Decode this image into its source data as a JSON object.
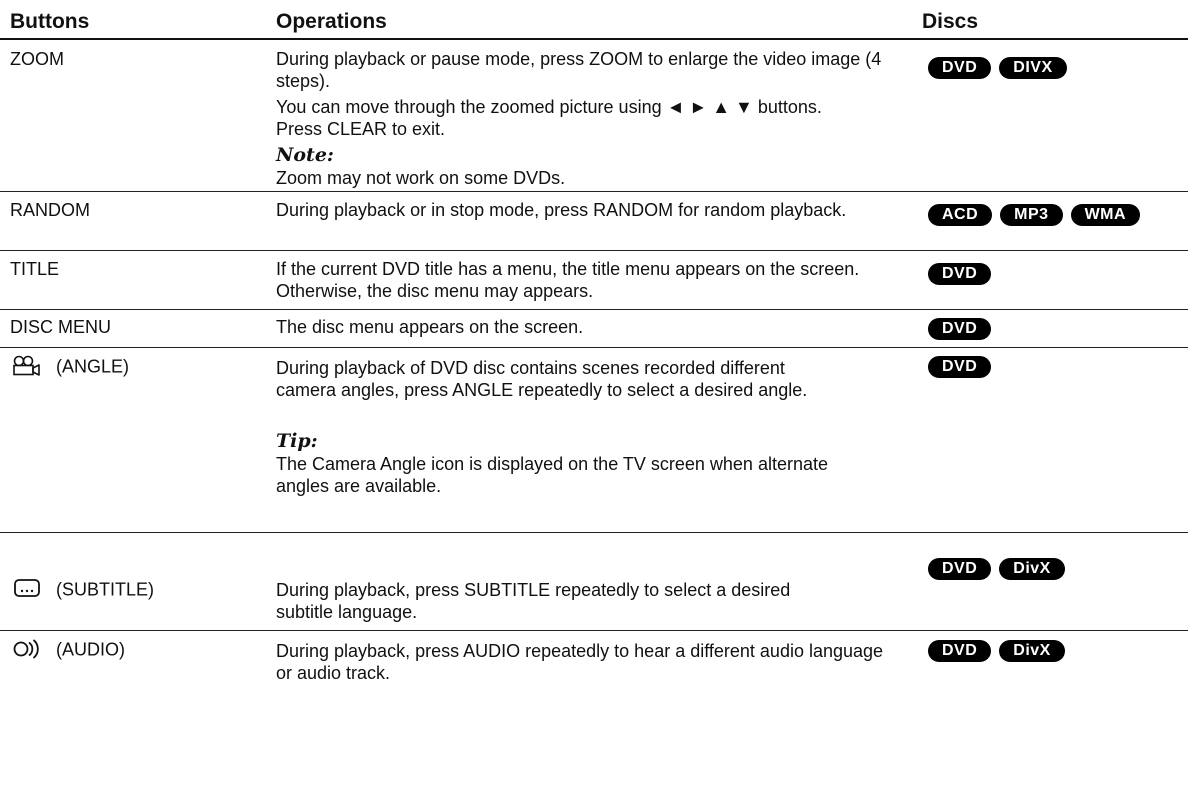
{
  "headers": {
    "buttons": "Buttons",
    "operations": "Operations",
    "discs": "Discs"
  },
  "rows": [
    {
      "button": "ZOOM",
      "lines": [
        "During playback or pause mode, press ZOOM to enlarge the video image (4 steps).",
        "You can move through the zoomed picture using ◄ ► ▲ ▼ buttons. Press CLEAR to exit."
      ],
      "note_label": "Note:",
      "note_text": "Zoom may not work on some DVDs.",
      "discs": [
        "DVD",
        "DIVX"
      ]
    },
    {
      "button": "RANDOM",
      "lines": [
        "During playback or in stop mode, press RANDOM for random playback."
      ],
      "discs": [
        "ACD",
        "MP3",
        "WMA"
      ]
    },
    {
      "button": "TITLE",
      "lines": [
        "If the current DVD title has a menu, the title menu appears on the screen. Otherwise, the disc menu may appears."
      ],
      "discs": [
        "DVD"
      ]
    },
    {
      "button": "DISC MENU",
      "lines": [
        "The disc menu appears on the screen."
      ],
      "discs": [
        "DVD"
      ]
    },
    {
      "button": "(ANGLE)",
      "icon": "camera-angle-icon",
      "lines": [
        "During playback of DVD disc contains scenes recorded different camera angles, press ANGLE repeatedly to select a desired angle."
      ],
      "tip_label": "Tip:",
      "tip_text": "The Camera Angle icon is displayed on the TV screen when alternate angles are available.",
      "discs": [
        "DVD"
      ]
    },
    {
      "button": "(SUBTITLE)",
      "icon": "subtitle-icon",
      "lines": [
        "During playback, press SUBTITLE repeatedly to select a desired subtitle language."
      ],
      "discs": [
        "DVD",
        "DivX"
      ]
    },
    {
      "button": "(AUDIO)",
      "icon": "audio-icon",
      "lines": [
        "During playback, press AUDIO repeatedly to hear a different audio language or audio track."
      ],
      "discs": [
        "DVD",
        "DivX"
      ]
    }
  ]
}
